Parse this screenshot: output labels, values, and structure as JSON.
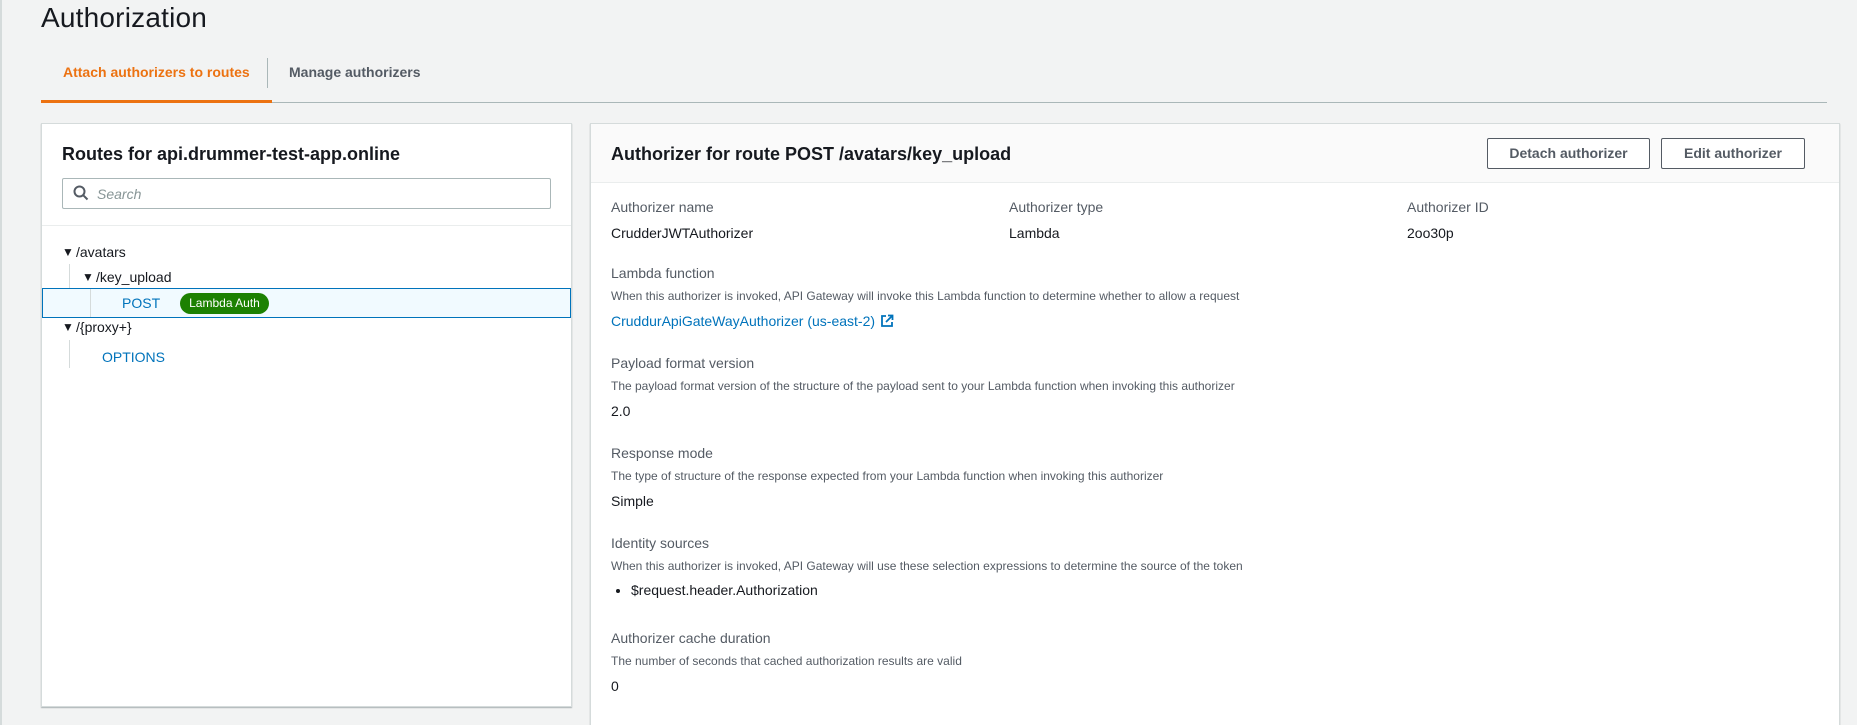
{
  "page": {
    "title": "Authorization"
  },
  "tabs": [
    {
      "label": "Attach authorizers to routes",
      "active": true
    },
    {
      "label": "Manage authorizers",
      "active": false
    }
  ],
  "routes": {
    "title": "Routes for api.drummer-test-app.online",
    "search_placeholder": "Search",
    "tree": [
      {
        "label": "/avatars",
        "type": "path",
        "expanded": true
      },
      {
        "label": "/key_upload",
        "type": "path",
        "expanded": true
      },
      {
        "label": "POST",
        "type": "method",
        "selected": true,
        "badge": "Lambda Auth"
      },
      {
        "label": "/{proxy+}",
        "type": "path",
        "expanded": true
      },
      {
        "label": "OPTIONS",
        "type": "method",
        "selected": false
      }
    ]
  },
  "detail": {
    "title": "Authorizer for route POST /avatars/key_upload",
    "buttons": {
      "detach": "Detach authorizer",
      "edit": "Edit authorizer"
    },
    "name_label": "Authorizer name",
    "name_value": "CrudderJWTAuthorizer",
    "type_label": "Authorizer type",
    "type_value": "Lambda",
    "id_label": "Authorizer ID",
    "id_value": "2oo30p",
    "lambda_label": "Lambda function",
    "lambda_desc": "When this authorizer is invoked, API Gateway will invoke this Lambda function to determine whether to allow a request",
    "lambda_value": "CruddurApiGateWayAuthorizer (us-east-2)",
    "payload_label": "Payload format version",
    "payload_desc": "The payload format version of the structure of the payload sent to your Lambda function when invoking this authorizer",
    "payload_value": "2.0",
    "response_label": "Response mode",
    "response_desc": "The type of structure of the response expected from your Lambda function when invoking this authorizer",
    "response_value": "Simple",
    "identity_label": "Identity sources",
    "identity_desc": "When this authorizer is invoked, API Gateway will use these selection expressions to determine the source of the token",
    "identity_values": [
      "$request.header.Authorization"
    ],
    "cache_label": "Authorizer cache duration",
    "cache_desc": "The number of seconds that cached authorization results are valid",
    "cache_value": "0"
  },
  "colors": {
    "accent": "#ec7211",
    "link": "#0073bb",
    "badge": "#1d8102"
  },
  "icons": {
    "search": "search-icon",
    "external": "external-link-icon",
    "caret": "caret-down-icon"
  }
}
